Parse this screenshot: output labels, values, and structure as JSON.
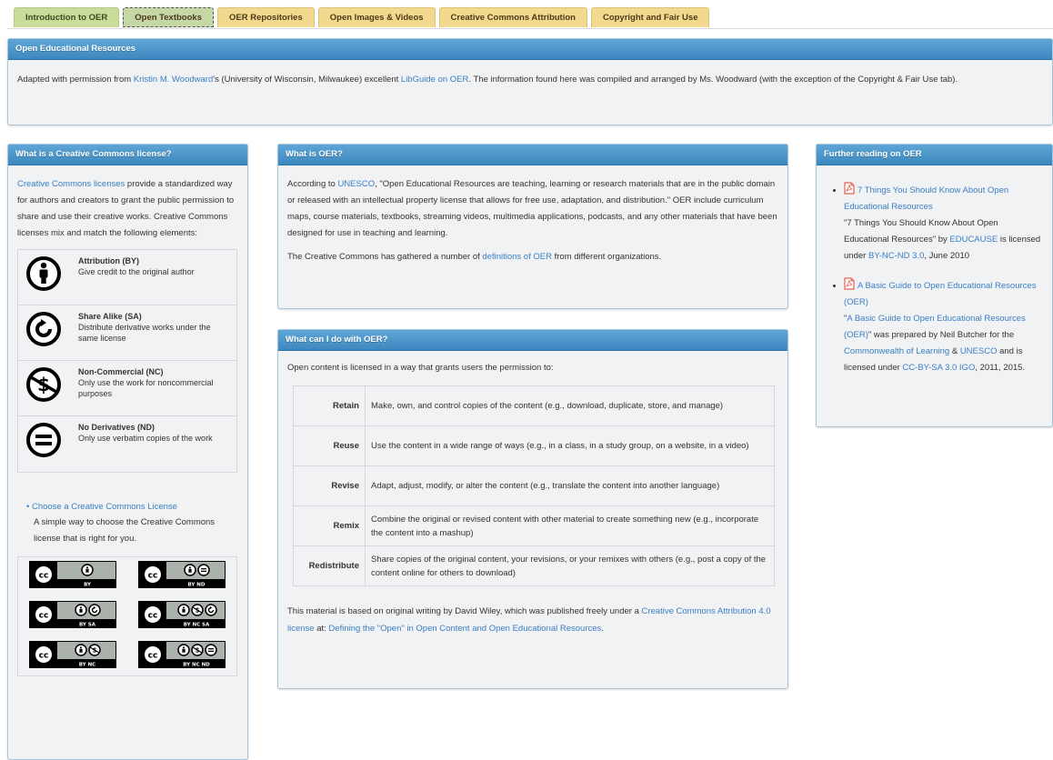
{
  "tabs": [
    {
      "label": "Introduction to OER",
      "style": "green"
    },
    {
      "label": "Open Textbooks",
      "style": "active"
    },
    {
      "label": "OER Repositories",
      "style": "gold"
    },
    {
      "label": "Open Images & Videos",
      "style": "gold"
    },
    {
      "label": "Creative Commons Attribution",
      "style": "gold"
    },
    {
      "label": "Copyright and Fair Use",
      "style": "gold"
    }
  ],
  "top_panel": {
    "title": "Open Educational Resources",
    "text_1": "Adapted with permission from ",
    "author_link": "Kristin M. Woodward",
    "text_2": "'s (University of Wisconsin, Milwaukee) excellent ",
    "libguide_link": "LibGuide on OER",
    "text_3": ".  The information found here was compiled and arranged by Ms. Woodward (with the exception of the Copyright & Fair Use tab)."
  },
  "left_panel": {
    "title": "What is a Creative Commons license?",
    "intro_link": "Creative Commons licenses",
    "intro_text": " provide a standardized way for authors and creators to grant the public permission to share and use their creative works. Creative Commons licenses mix and match the following elements:",
    "elements": [
      {
        "title": "Attribution (BY)",
        "desc": "Give credit to the original author",
        "icon": "attribution-icon"
      },
      {
        "title": "Share Alike (SA)",
        "desc": "Distribute derivative works under the same license",
        "icon": "share-alike-icon"
      },
      {
        "title": "Non-Commercial (NC)",
        "desc": "Only use the work for noncommercial purposes",
        "icon": "non-commercial-icon"
      },
      {
        "title": "No Derivatives (ND)",
        "desc": "Only use verbatim copies of the work",
        "icon": "no-derivatives-icon"
      }
    ],
    "choose_link": "Choose a Creative Commons License",
    "choose_text": "A simple way to choose the Creative Commons license that is right for you.",
    "badges": [
      {
        "label": "BY",
        "icons": [
          "by"
        ]
      },
      {
        "label": "BY  ND",
        "icons": [
          "by",
          "nd"
        ]
      },
      {
        "label": "BY  SA",
        "icons": [
          "by",
          "sa"
        ]
      },
      {
        "label": "BY  NC  SA",
        "icons": [
          "by",
          "nc",
          "sa"
        ]
      },
      {
        "label": "BY  NC",
        "icons": [
          "by",
          "nc"
        ]
      },
      {
        "label": "BY  NC  ND",
        "icons": [
          "by",
          "nc",
          "nd"
        ]
      }
    ]
  },
  "what_is_oer": {
    "title": "What is OER?",
    "p1_a": "According to ",
    "unesco_link": "UNESCO",
    "p1_b": ", \"Open Educational Resources are teaching, learning or research materials that are in the public domain or released with an intellectual property license that allows for free use, adaptation, and distribution.\" OER include curriculum maps, course materials, textbooks, streaming videos, multimedia applications, podcasts, and any other materials that have been designed for use in teaching and learning.",
    "p2_a": "The Creative Commons has gathered a number of ",
    "definitions_link": "definitions of OER",
    "p2_b": " from different organizations."
  },
  "what_can_i_do": {
    "title": "What can I do with OER?",
    "intro": "Open content is licensed in a way that grants users the permission to:",
    "rows": [
      {
        "key": "Retain",
        "value": "Make, own, and control copies of the content (e.g., download, duplicate, store, and manage)"
      },
      {
        "key": "Reuse",
        "value": "Use the content in a wide range of ways (e.g., in a class, in a study group, on a website, in a video)"
      },
      {
        "key": "Revise",
        "value": "Adapt, adjust, modify, or alter the content (e.g., translate the content into another language)"
      },
      {
        "key": "Remix",
        "value": "Combine the original or revised content with other material to create something new (e.g., incorporate the content into a mashup)"
      },
      {
        "key": "Redistribute",
        "value": "Share copies of the original content, your revisions, or your remixes with others (e.g., post a copy of the content online for others to download)"
      }
    ],
    "footer_a": "This material is based on original writing by David Wiley, which was published freely under a ",
    "cc_link": "Creative Commons Attribution 4.0 license",
    "footer_b": " at: ",
    "defining_link": "Defining the \"Open\" in Open Content and Open Educational Resources",
    "footer_c": "."
  },
  "further_reading": {
    "title": "Further reading on OER",
    "items": [
      {
        "link": "7 Things You Should Know About Open Educational Resources",
        "desc_a": "\"7 Things You Should Know About Open Educational Resources\" by ",
        "org_link": "EDUCAUSE",
        "desc_b": " is licensed under ",
        "license_link": "BY-NC-ND 3.0",
        "desc_c": ", June 2010"
      },
      {
        "link": "A Basic Guide to Open Educational Resources (OER)",
        "desc_a": "\"",
        "title_link": "A Basic Guide to Open Educational Resources (OER)",
        "desc_b": "\" was prepared by Neil Butcher for the ",
        "org_link": "Commonwealth of Learning",
        "desc_c": " & ",
        "org2_link": "UNESCO",
        "desc_d": " and is licensed under ",
        "license_link": "CC-BY-SA 3.0 IGO",
        "desc_e": ", 2011, 2015."
      }
    ]
  }
}
